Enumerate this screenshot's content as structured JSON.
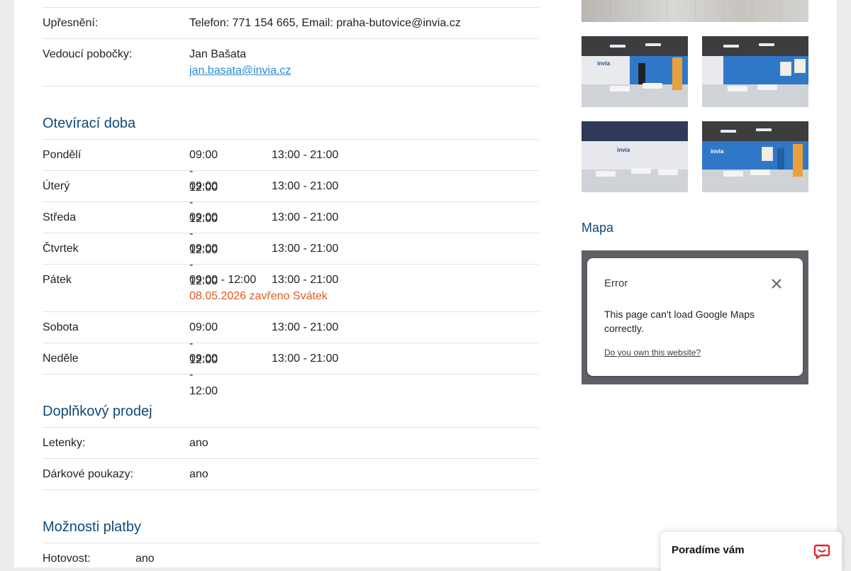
{
  "branch": {
    "detail": {
      "label": "Upřesnění:",
      "value": "Telefon: 771 154 665, Email: praha-butovice@invia.cz"
    },
    "manager": {
      "label": "Vedoucí pobočky:",
      "name": "Jan Bašata",
      "email": "jan.basata@invia.cz"
    }
  },
  "opening_hours": {
    "title": "Otevírací doba",
    "days": [
      {
        "day": "Pondělí",
        "morning": "09:00 - 12:00",
        "afternoon": "13:00 - 21:00"
      },
      {
        "day": "Úterý",
        "morning": "09:00 - 12:00",
        "afternoon": "13:00 - 21:00"
      },
      {
        "day": "Středa",
        "morning": "09:00 - 12:00",
        "afternoon": "13:00 - 21:00"
      },
      {
        "day": "Čtvrtek",
        "morning": "09:00 - 12:00",
        "afternoon": "13:00 - 21:00"
      },
      {
        "day": "Pátek",
        "morning": "09:00 - 12:00",
        "afternoon": "13:00 - 21:00",
        "note": "08.05.2026 zavřeno Svátek"
      },
      {
        "day": "Sobota",
        "morning": "09:00 - 12:00",
        "afternoon": "13:00 - 21:00"
      },
      {
        "day": "Neděle",
        "morning": "09:00 - 12:00",
        "afternoon": "13:00 - 21:00"
      }
    ]
  },
  "extra_sales": {
    "title": "Doplňkový prodej",
    "items": [
      {
        "label": "Letenky:",
        "value": "ano"
      },
      {
        "label": "Dárkové poukazy:",
        "value": "ano"
      }
    ]
  },
  "payment": {
    "title": "Možnosti platby",
    "items": [
      {
        "label": "Hotovost:",
        "value": "ano"
      }
    ]
  },
  "gallery": {
    "logo_text": "invia"
  },
  "map": {
    "title": "Mapa",
    "error_title": "Error",
    "error_message": "This page can't load Google Maps correctly.",
    "error_link": "Do you own this website?"
  },
  "chat": {
    "label": "Poradíme vám"
  },
  "colors": {
    "accent": "#0e4a7a",
    "link": "#2a8bd4",
    "warning": "#e05a1d"
  }
}
